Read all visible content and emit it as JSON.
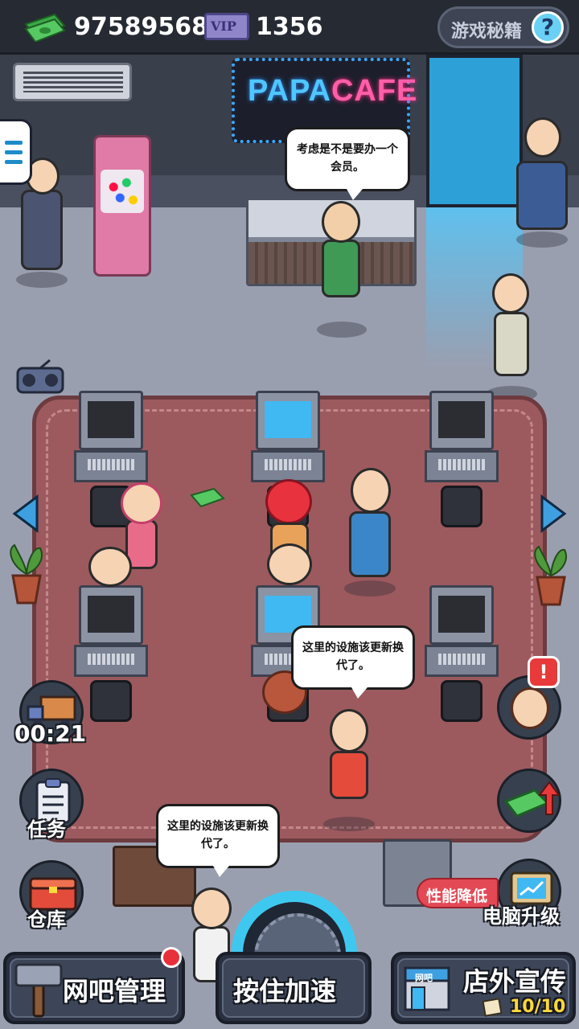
{
  "hud": {
    "cash": "97589568",
    "vip_badge": "VIP",
    "vip_points": "1356",
    "tips_button": "游戏秘籍",
    "help_glyph": "?"
  },
  "scene": {
    "cafe_sign": {
      "part1": "PAPA",
      "part2": "CAFE"
    },
    "bubbles": {
      "counter_girl": "考虑是不是要办一个会员。",
      "customer_red_shirt": "这里的设施该更新换代了。",
      "old_man": "这里的设施该更新换代了。"
    },
    "colors": {
      "floor": "#9a9fb0",
      "rug": "#9c5a5e",
      "screen_on": "#40b8f2",
      "accent": "#3ec8f0"
    }
  },
  "side": {
    "delivery_timer": "00:21",
    "tasks_label": "任务",
    "warehouse_label": "仓库",
    "perf_badge": "性能降低",
    "upgrade_label": "电脑升级",
    "warn_glyph": "!"
  },
  "bottom": {
    "manage_label": "网吧管理",
    "speed_label": "按住加速",
    "promo_label": "店外宣传",
    "promo_sign": "网吧",
    "promo_count": "10/10"
  }
}
